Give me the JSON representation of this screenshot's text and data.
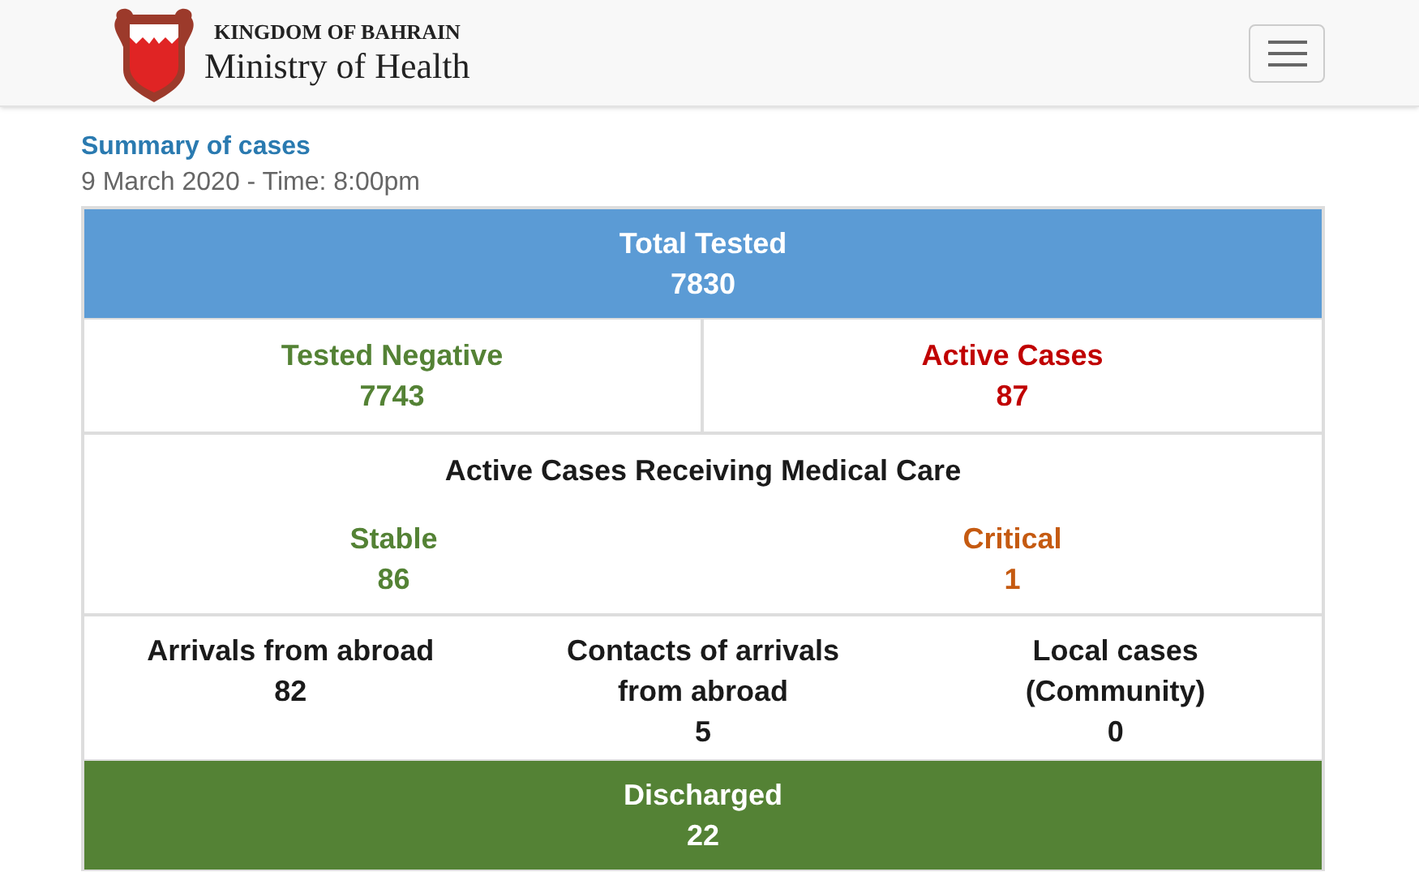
{
  "header": {
    "kicker": "KINGDOM OF BAHRAIN",
    "title": "Ministry of Health"
  },
  "summary": {
    "title": "Summary of cases",
    "date": "9 March 2020 - Time: 8:00pm"
  },
  "sections": [
    {
      "kind": "banner",
      "color": "#5b9bd5",
      "label": "Total Tested",
      "value": "7830"
    },
    {
      "kind": "pair",
      "cells": [
        {
          "label": "Tested Negative",
          "value": "7743",
          "color": "#548235"
        },
        {
          "label": "Active Cases",
          "value": "87",
          "color": "#c00000"
        }
      ]
    },
    {
      "kind": "care",
      "title": "Active Cases Receiving Medical Care",
      "cells": [
        {
          "label": "Stable",
          "value": "86",
          "color": "#548235"
        },
        {
          "label": "Critical",
          "value": "1",
          "color": "#c55a11"
        }
      ]
    },
    {
      "kind": "trio",
      "cells": [
        {
          "label": "Arrivals from abroad",
          "value": "82",
          "color": "#1a1a1a"
        },
        {
          "label": "Contacts of arrivals from abroad",
          "value": "5",
          "color": "#1a1a1a"
        },
        {
          "label": "Local cases (Community)",
          "value": "0",
          "color": "#1a1a1a"
        }
      ]
    },
    {
      "kind": "banner",
      "color": "#548235",
      "label": "Discharged",
      "value": "22"
    }
  ]
}
